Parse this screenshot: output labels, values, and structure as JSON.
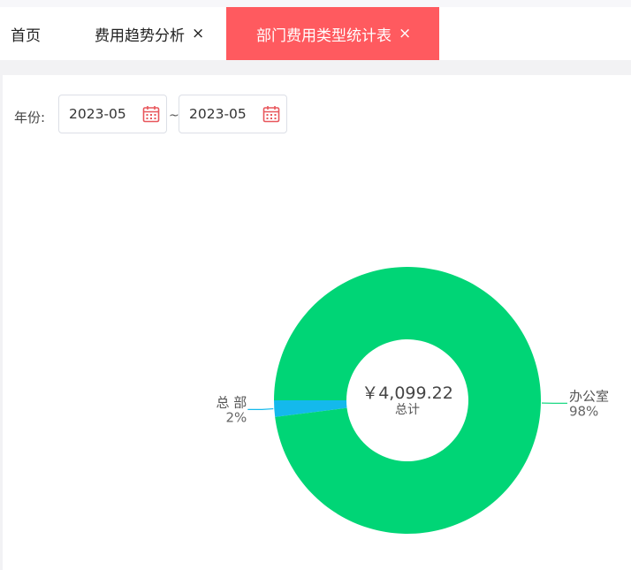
{
  "tabs": [
    {
      "label": "首页",
      "closable": false,
      "active": false
    },
    {
      "label": "费用趋势分析",
      "closable": true,
      "active": false
    },
    {
      "label": "部门费用类型统计表",
      "closable": true,
      "active": true
    }
  ],
  "tab_close_glyph": "×",
  "filter": {
    "label": "年份:",
    "start": "2023-05",
    "end": "2023-05",
    "separator": "~",
    "calendar_icon": "calendar-icon"
  },
  "colors": {
    "active_tab": "#ff5a5f",
    "calendar_icon": "#e8575c"
  },
  "chart_data": {
    "type": "pie",
    "donut": true,
    "center_value": "￥4,099.22",
    "center_label": "总计",
    "slices": [
      {
        "name": "总 部",
        "percent_label": "2%",
        "value": 2,
        "color": "#14b9ec"
      },
      {
        "name": "办公室",
        "percent_label": "98%",
        "value": 98,
        "color": "#00d576"
      }
    ]
  }
}
